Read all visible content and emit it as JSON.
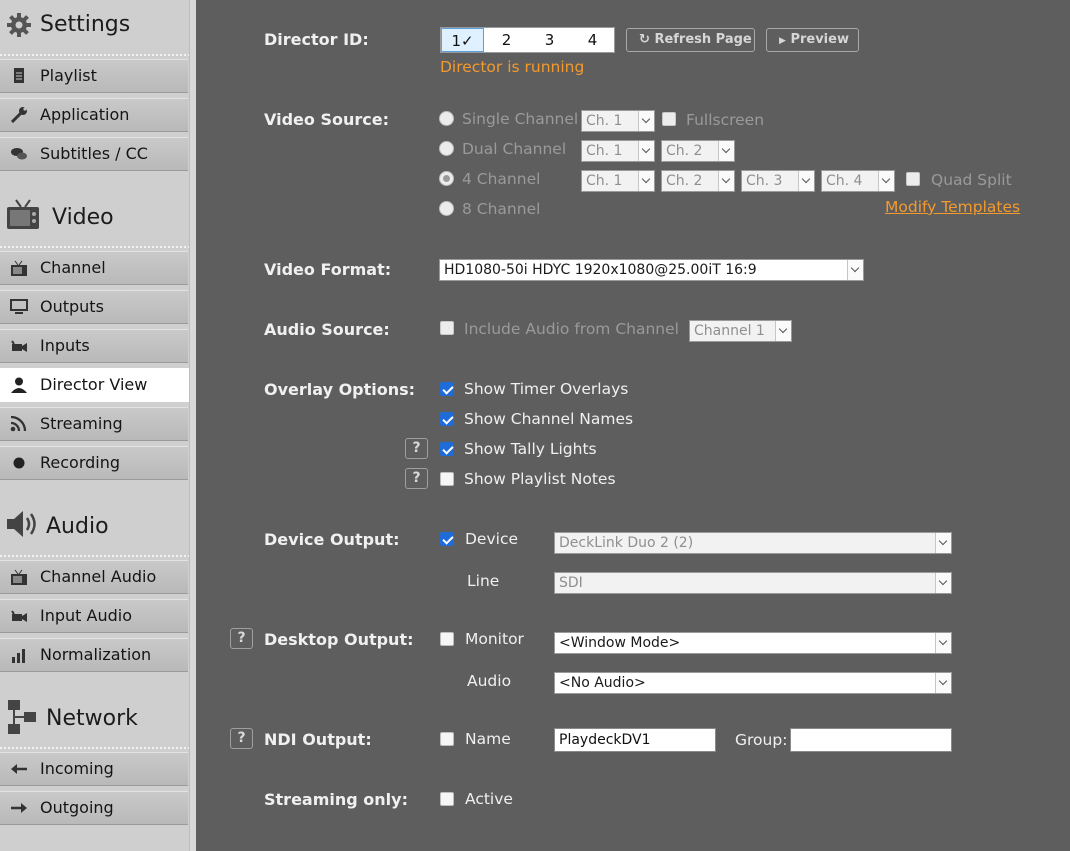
{
  "sidebar": {
    "sections": [
      {
        "title": "Settings",
        "icon": "gear-icon",
        "items": [
          {
            "label": "Playlist",
            "icon": "document-icon"
          },
          {
            "label": "Application",
            "icon": "wrench-icon"
          },
          {
            "label": "Subtitles / CC",
            "icon": "speech-bubbles-icon"
          }
        ]
      },
      {
        "title": "Video",
        "icon": "tv-icon",
        "items": [
          {
            "label": "Channel",
            "icon": "tv-icon"
          },
          {
            "label": "Outputs",
            "icon": "monitor-icon"
          },
          {
            "label": "Inputs",
            "icon": "camera-icon"
          },
          {
            "label": "Director View",
            "icon": "person-icon"
          },
          {
            "label": "Streaming",
            "icon": "rss-icon"
          },
          {
            "label": "Recording",
            "icon": "record-dot-icon"
          }
        ]
      },
      {
        "title": "Audio",
        "icon": "speaker-icon",
        "items": [
          {
            "label": "Channel Audio",
            "icon": "tv-icon"
          },
          {
            "label": "Input Audio",
            "icon": "camera-icon"
          },
          {
            "label": "Normalization",
            "icon": "bar-chart-icon"
          }
        ]
      },
      {
        "title": "Network",
        "icon": "network-icon",
        "items": [
          {
            "label": "Incoming",
            "icon": "arrow-left-icon"
          },
          {
            "label": "Outgoing",
            "icon": "arrow-right-icon"
          }
        ]
      }
    ],
    "active_item": "Director View"
  },
  "director": {
    "label": "Director ID:",
    "ids": [
      "1✓",
      "2",
      "3",
      "4"
    ],
    "selected": "1✓",
    "refresh_label": "Refresh Page",
    "preview_label": "Preview",
    "status": "Director is running"
  },
  "video_source": {
    "label": "Video Source:",
    "options": [
      "Single Channel",
      "Dual Channel",
      "4 Channel",
      "8 Channel"
    ],
    "selected": "4 Channel",
    "single": {
      "ch": "Ch. 1",
      "fullscreen": "Fullscreen"
    },
    "dual": [
      "Ch. 1",
      "Ch. 2"
    ],
    "quad": [
      "Ch. 1",
      "Ch. 2",
      "Ch. 3",
      "Ch. 4"
    ],
    "quad_split": "Quad Split",
    "modify_templates": "Modify Templates"
  },
  "video_format": {
    "label": "Video Format:",
    "value": "HD1080-50i HDYC 1920x1080@25.00iT 16:9"
  },
  "audio_source": {
    "label": "Audio Source:",
    "checkbox": "Include Audio from Channel",
    "channel": "Channel 1"
  },
  "overlay": {
    "label": "Overlay Options:",
    "options": [
      {
        "label": "Show Timer Overlays",
        "checked": true
      },
      {
        "label": "Show Channel Names",
        "checked": true
      },
      {
        "label": "Show Tally Lights",
        "checked": true
      },
      {
        "label": "Show Playlist Notes",
        "checked": false
      }
    ],
    "help": "?"
  },
  "device_output": {
    "label": "Device Output:",
    "device_label": "Device",
    "device": "DeckLink Duo 2 (2)",
    "line_label": "Line",
    "line": "SDI"
  },
  "desktop_output": {
    "label": "Desktop Output:",
    "monitor_label": "Monitor",
    "monitor": "<Window Mode>",
    "audio_label": "Audio",
    "audio": "<No Audio>"
  },
  "ndi_output": {
    "label": "NDI Output:",
    "name_label": "Name",
    "name_value": "PlaydeckDV1",
    "group_label": "Group:",
    "group_value": ""
  },
  "streaming_only": {
    "label": "Streaming only:",
    "active_label": "Active"
  }
}
